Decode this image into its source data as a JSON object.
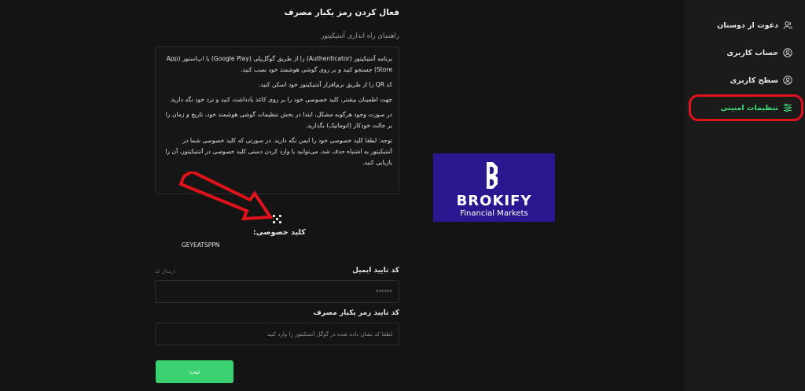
{
  "sidebar": {
    "items": [
      {
        "label": "دعوت از دوستان",
        "icon": "users-icon"
      },
      {
        "label": "حساب کاربری",
        "icon": "user-circle-icon"
      },
      {
        "label": "سطح کاربری",
        "icon": "user-level-icon"
      },
      {
        "label": "تنظیمات امنیتی",
        "icon": "sliders-icon",
        "active": true
      }
    ],
    "accent_color": "#3ee07a",
    "highlight_color": "#e0121c"
  },
  "main": {
    "title": "فعال کردن رمز یکبار مصرف",
    "guide_title": "راهنمای راه اندازی آتنتیکیتور",
    "guide_paragraphs": [
      "برنامه آتنتیکیتور (Authenticator) را از طریق گوگل‌پلی (Google Play) یا اپ‌استور (App Store) جستجو کنید و بر روی گوشی هوشمند خود نصب کنید.",
      "کد QR را از طریق نرم‌افزار آتنتیکیتور خود اسکن کنید.",
      "جهت اطمینان بیشتر، کلید خصوصی خود را بر روی کاغذ یادداشت کنید و نزد خود نگه دارید.",
      "در صورت وجود هرگونه مشکل، ابتدا در بخش تنظیمات گوشی هوشمند خود، تاریخ و زمان را بر حالت خودکار (اتوماتیک) بگذارید.",
      "توجه: لطفا کلید خصوصی خود را ایمن نگه دارید. در صورتی که کلید خصوصی شما در آتنتیکیتور به اشتباه حذف شد، می‌توانید با وارد کردن دستی کلید خصوصی در آتنتیکیتور، آن را بازیابی کنید."
    ],
    "qr_icon": "qr-code-icon",
    "private_key_label": "کلید خصوصی:",
    "private_key_value": "GEYEATSPPN",
    "email_code_label": "کد تایید ایمیل",
    "send_code_label": "ارسال کد",
    "email_code_value": "******",
    "otp_label": "کد تایید رمز یکبار مصرف",
    "otp_placeholder": "لطفا کد نشان داده شده در گوگل آتنتیکیتور را وارد کنید",
    "submit_label": "ثبت",
    "submit_color": "#3ad270"
  },
  "logo": {
    "brand": "BROKIFY",
    "tagline": "Financial Markets",
    "background": "#2a178f"
  }
}
